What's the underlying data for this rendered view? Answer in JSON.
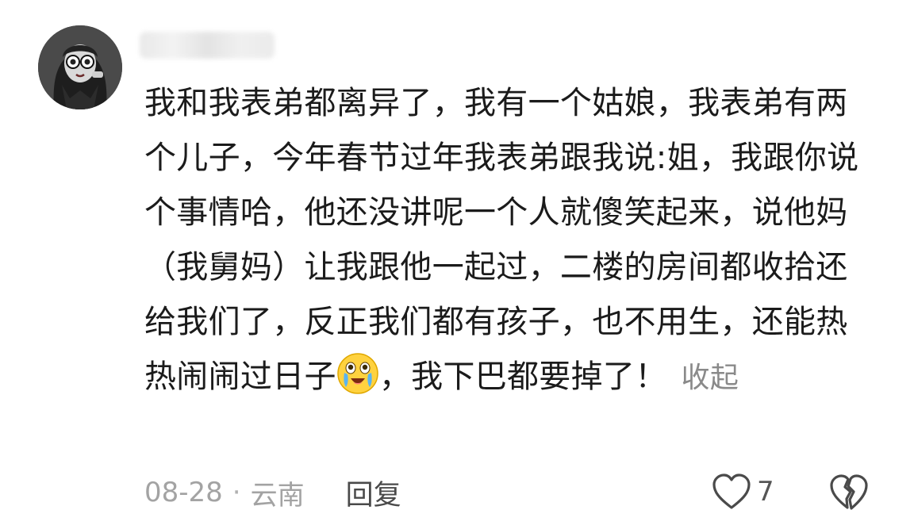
{
  "comment": {
    "text_before_emoji": "我和我表弟都离异了，我有一个姑娘，我表弟有两个儿子，今年春节过年我表弟跟我说:姐，我跟你说个事情哈，他还没讲呢一个人就傻笑起来，说他妈（我舅妈）让我跟他一起过，二楼的房间都收拾还给我们了，反正我们都有孩子，也不用生，还能热热闹闹过日子",
    "text_after_emoji": "，我下巴都要掉了！",
    "collapse_label": "收起",
    "emoji_icon": "crying-laughing-emoji-icon"
  },
  "meta": {
    "date": "08-28",
    "separator": "·",
    "location": "云南",
    "reply_label": "回复"
  },
  "actions": {
    "like_count": "7",
    "like_icon": "heart-outline-icon",
    "dislike_icon": "broken-heart-icon"
  }
}
